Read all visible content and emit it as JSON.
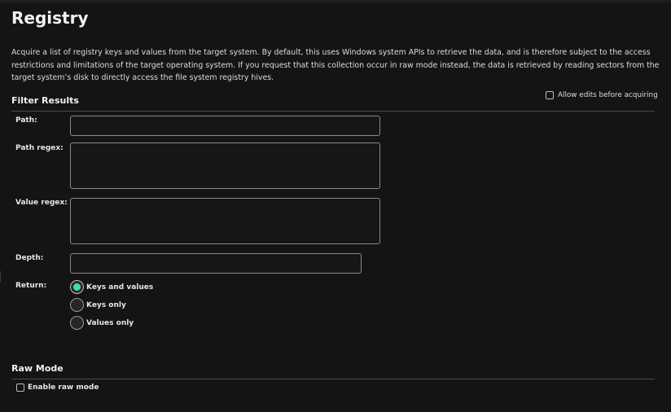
{
  "page": {
    "title": "Registry",
    "description": "Acquire a list of registry keys and values from the target system. By default, this uses Windows system APIs to retrieve the data, and is therefore subject to the access restrictions and limitations of the target operating system. If you request that this collection occur in raw mode instead, the data is retrieved by reading sectors from the target system’s disk to directly access the file system registry hives."
  },
  "allow_edits": {
    "label": "Allow edits before acquiring",
    "checked": false
  },
  "filter_results": {
    "title": "Filter Results",
    "path": {
      "label": "Path:",
      "value": ""
    },
    "path_regex": {
      "label": "Path regex:",
      "value": ""
    },
    "value_regex": {
      "label": "Value regex:",
      "value": ""
    },
    "depth": {
      "label": "Depth:",
      "value": ""
    },
    "return": {
      "label": "Return:",
      "options": [
        "Keys and values",
        "Keys only",
        "Values only"
      ],
      "selected": "Keys and values"
    }
  },
  "raw_mode": {
    "title": "Raw Mode",
    "enable_label": "Enable raw mode",
    "checked": false
  },
  "colors": {
    "accent": "#3fe0a8",
    "background": "#141414",
    "border": "#8a8a8a"
  }
}
